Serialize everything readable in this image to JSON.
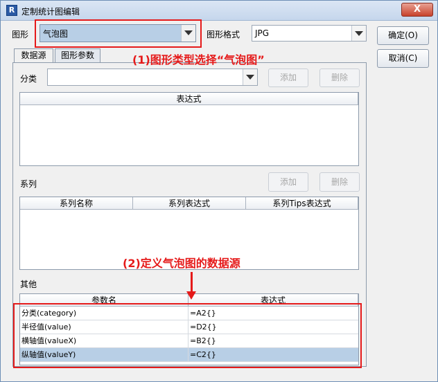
{
  "window": {
    "title": "定制统计图编辑",
    "close_glyph": "X",
    "app_icon_glyph": "R"
  },
  "top": {
    "graph_label": "图形",
    "graph_value": "气泡图",
    "format_label": "图形格式",
    "format_value": "JPG"
  },
  "buttons": {
    "ok": "确定(O)",
    "cancel": "取消(C)"
  },
  "tabs": [
    {
      "label": "数据源"
    },
    {
      "label": "图形参数"
    }
  ],
  "category": {
    "label": "分类",
    "add": "添加",
    "delete": "删除",
    "header": "表达式"
  },
  "series": {
    "label": "系列",
    "add": "添加",
    "delete": "删除",
    "headers": [
      "系列名称",
      "系列表达式",
      "系列Tips表达式"
    ]
  },
  "other": {
    "label": "其他",
    "headers": [
      "参数名",
      "表达式"
    ],
    "rows": [
      {
        "name": "分类(category)",
        "expr": "=A2{}"
      },
      {
        "name": "半径值(value)",
        "expr": "=D2{}"
      },
      {
        "name": "横轴值(valueX)",
        "expr": "=B2{}"
      },
      {
        "name": "纵轴值(valueY)",
        "expr": "=C2{}"
      }
    ]
  },
  "annotations": {
    "step1": "(1)图形类型选择“气泡图”",
    "step2": "(2)定义气泡图的数据源"
  },
  "colors": {
    "accent_red": "#e51a1a",
    "selection_blue": "#b8cfe6"
  }
}
